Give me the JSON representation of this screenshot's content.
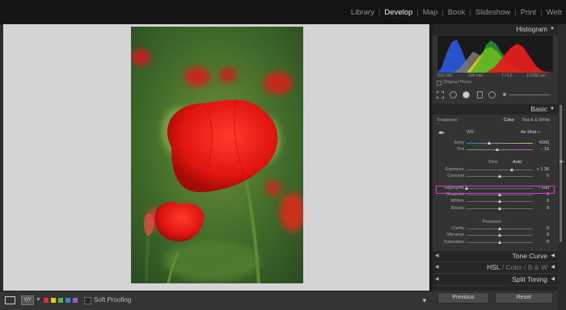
{
  "modules": [
    "Library",
    "Develop",
    "Map",
    "Book",
    "Slideshow",
    "Print",
    "Web"
  ],
  "active_module": "Develop",
  "toolbar": {
    "view_icon": "loupe-view-icon",
    "compare_label": "Y|Y",
    "flags": [
      "#e03030",
      "#e3d000",
      "#4fb84f",
      "#3f7fe0",
      "#9b59c9"
    ],
    "soft_proofing": "Soft Proofing"
  },
  "histogram": {
    "title": "Histogram",
    "iso": "ISO 200",
    "focal": "100 mm",
    "aperture": "f / 5.6",
    "shutter": "1/1600 sec",
    "original_photo": "Original Photo"
  },
  "basic": {
    "title": "Basic",
    "treatment_label": "Treatment :",
    "color_label": "Color",
    "bw_label": "Black & White",
    "wb_label": "WB :",
    "wb_value": "As Shot ÷",
    "tone_label": "Tone",
    "auto_label": "Auto",
    "presence_label": "Presence",
    "sliders": [
      {
        "label": "Temp",
        "value": "4300",
        "level": 0.34
      },
      {
        "label": "Tint",
        "value": "− 16",
        "level": 0.46
      },
      {
        "label": "Exposure",
        "value": "+ 1.36",
        "level": 0.68
      },
      {
        "label": "Contrast",
        "value": "0",
        "level": 0.5
      },
      {
        "label": "Highlights",
        "value": "− 100",
        "level": 0.0
      },
      {
        "label": "Shadows",
        "value": "0",
        "level": 0.5
      },
      {
        "label": "Whites",
        "value": "0",
        "level": 0.5
      },
      {
        "label": "Blacks",
        "value": "0",
        "level": 0.5
      },
      {
        "label": "Clarity",
        "value": "0",
        "level": 0.5
      },
      {
        "label": "Vibrance",
        "value": "0",
        "level": 0.5
      },
      {
        "label": "Saturation",
        "value": "0",
        "level": 0.5
      }
    ]
  },
  "panels": {
    "tone_curve": "Tone Curve",
    "hsl": "HSL",
    "hsl_color": "Color",
    "hsl_bw": "B & W",
    "split_toning": "Split Toning"
  },
  "buttons": {
    "previous": "Previous",
    "reset": "Reset"
  },
  "colors": {
    "highlight_box": "#d63bd6",
    "panel_bg": "#333333",
    "canvas_bg": "#d4d4d4"
  }
}
